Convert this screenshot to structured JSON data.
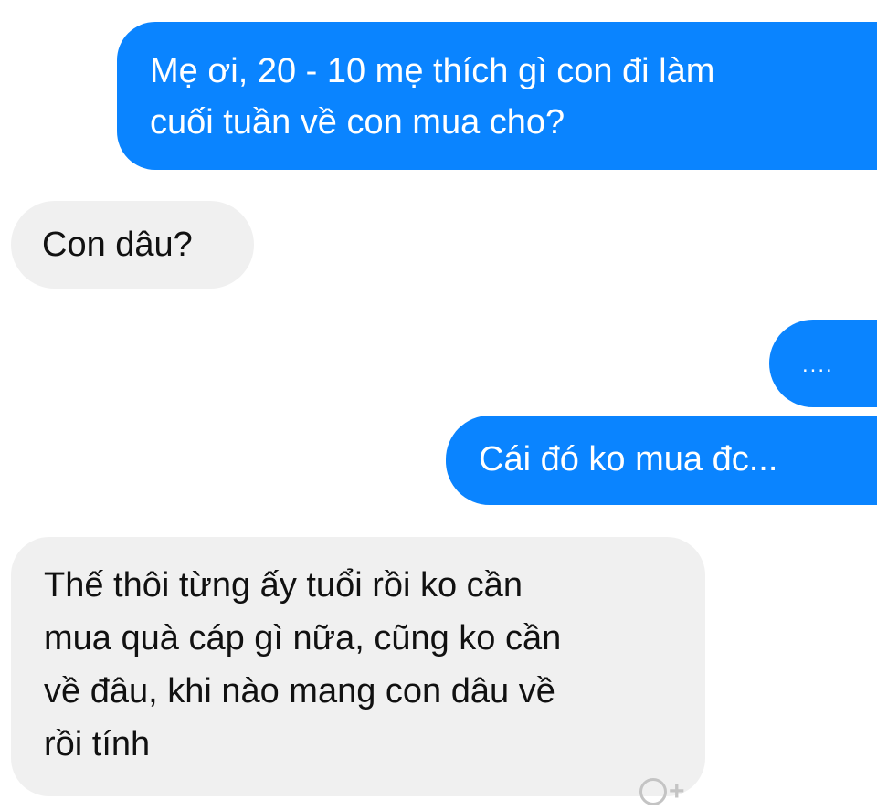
{
  "conversation": {
    "messages": [
      {
        "sender": "me",
        "text": "Mẹ ơi, 20 - 10 mẹ thích gì con đi làm\ncuối tuần về con mua cho?"
      },
      {
        "sender": "other",
        "text": "Con dâu?"
      },
      {
        "sender": "me",
        "text": "...."
      },
      {
        "sender": "me",
        "text": "Cái đó ko mua đc..."
      },
      {
        "sender": "other",
        "text": "Thế thôi từng ấy tuổi rồi ko cần\nmua quà cáp gì nữa, cũng ko cần\nvề đâu, khi nào mang con dâu về\nrồi tính"
      }
    ]
  },
  "colors": {
    "sent_bubble": "#0a84ff",
    "received_bubble": "#f0f0f0"
  },
  "icons": {
    "reaction": "add-reaction-icon"
  }
}
